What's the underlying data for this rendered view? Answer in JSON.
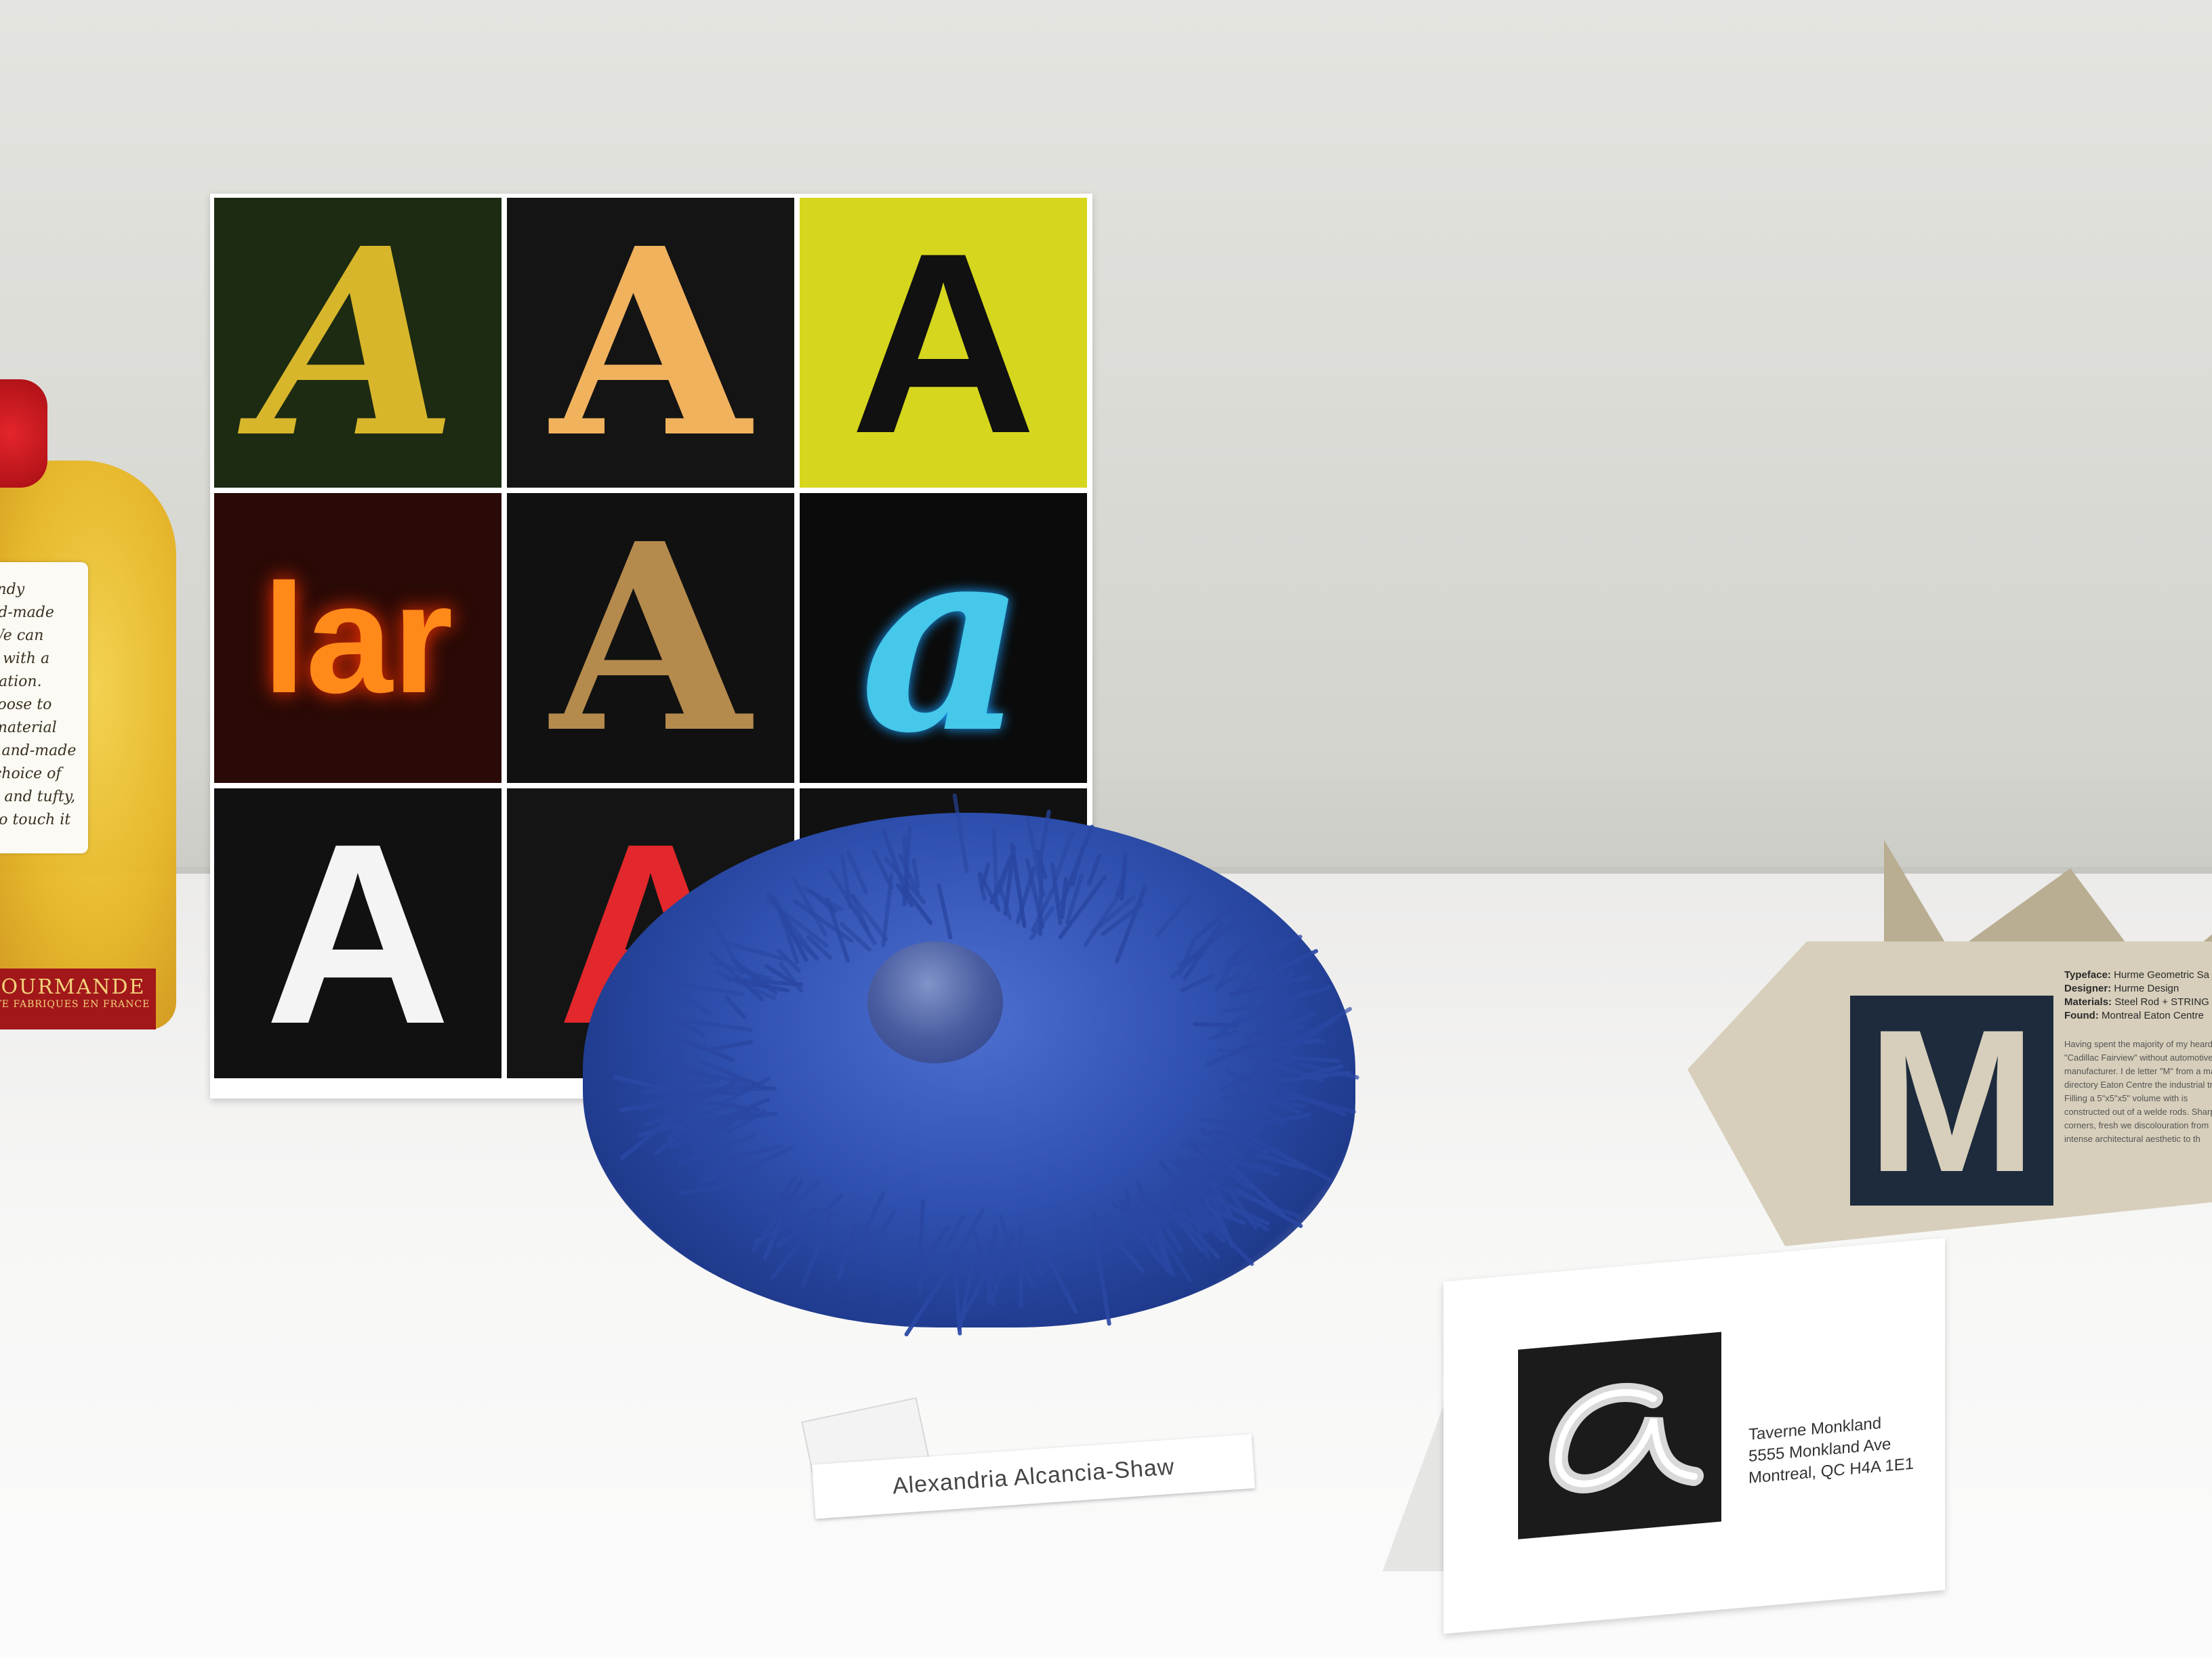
{
  "scene": {
    "description_objects": [
      "poster",
      "pompom",
      "name-label",
      "tent-card",
      "m-card",
      "candy-bag"
    ]
  },
  "candy_bag": {
    "tag_lines": [
      "candy",
      "and-made",
      ". We can",
      "de with a",
      "ligation.",
      "choose to",
      "a material",
      "s hand-made",
      "e choice of",
      "ful and tufty,",
      "y to touch it"
    ],
    "label_line1": "GOURMANDE",
    "label_line2": "AUTE FABRIQUES EN FRANCE"
  },
  "poster": {
    "tiles": [
      {
        "glyph": "A",
        "bg": "#1c2b12",
        "fg": "#d8b62c",
        "font": "serif",
        "style": "italic"
      },
      {
        "glyph": "A",
        "bg": "#141414",
        "fg": "#f1b25e",
        "font": "serif",
        "style": "normal"
      },
      {
        "glyph": "A",
        "bg": "#d6d61e",
        "fg": "#111111",
        "font": "sans",
        "style": "normal"
      },
      {
        "glyph": "lar",
        "bg": "#2a0a06",
        "fg": "#ff8a1a",
        "font": "sans",
        "style": "normal"
      },
      {
        "glyph": "A",
        "bg": "#111111",
        "fg": "#b58a4d",
        "font": "serif",
        "style": "normal"
      },
      {
        "glyph": "a",
        "bg": "#0b0b0b",
        "fg": "#45c8ea",
        "font": "serif",
        "style": "italic"
      },
      {
        "glyph": "A",
        "bg": "#111111",
        "fg": "#f4f4f4",
        "font": "sans",
        "style": "normal"
      },
      {
        "glyph": "A",
        "bg": "#141414",
        "fg": "#e2282c",
        "font": "sans",
        "style": "normal"
      },
      {
        "glyph": "",
        "bg": "#111111",
        "fg": "#111111",
        "font": "sans",
        "style": "normal"
      }
    ]
  },
  "name_label": {
    "text": "Alexandria Alcancia-Shaw"
  },
  "tent_card": {
    "glyph": "a",
    "line1": "Taverne Monkland",
    "line2": "5555 Monkland Ave",
    "line3": "Montreal, QC H4A 1E1"
  },
  "m_card": {
    "glyph": "M",
    "typeface_label": "Typeface:",
    "typeface_value": "Hurme Geometric Sa",
    "designer_label": "Designer:",
    "designer_value": "Hurme Design",
    "materials_label": "Materials:",
    "materials_value": "Steel Rod + STRING",
    "found_label": "Found:",
    "found_value": "Montreal Eaton Centre",
    "body": "Having spent the majority of my heard \"Cadillac Fairview\" without automotive manufacturer. I de letter \"M\" from a mall directory Eaton Centre the industrial tre Filling a 5\"x5\"x5\" volume with is constructed out of a welde rods. Sharp corners, fresh we discolouration from intense architectural aesthetic to th"
  },
  "colors": {
    "pompom": "#2e4fae",
    "wall": "#dcdcd8",
    "table": "#f7f7f6"
  }
}
